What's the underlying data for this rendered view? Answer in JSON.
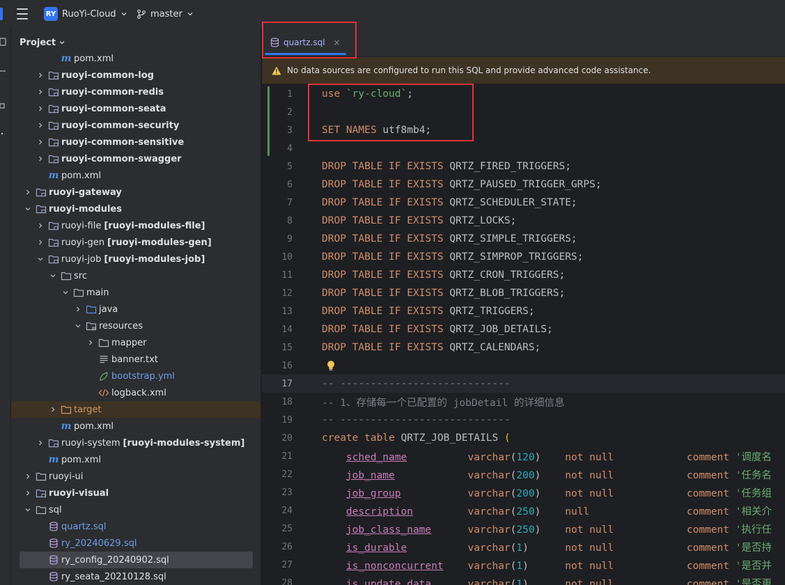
{
  "titlebar": {
    "project_badge": "RY",
    "project_name": "RuoYi-Cloud",
    "branch_name": "master"
  },
  "project_panel": {
    "title": "Project",
    "tree": [
      {
        "label": "pom.xml",
        "icon": "maven-icon",
        "depth": 4,
        "arrow": "none"
      },
      {
        "label": "ruoyi-common-log",
        "icon": "module-folder-icon",
        "depth": 3,
        "arrow": "right",
        "bold": true
      },
      {
        "label": "ruoyi-common-redis",
        "icon": "module-folder-icon",
        "depth": 3,
        "arrow": "right",
        "bold": true
      },
      {
        "label": "ruoyi-common-seata",
        "icon": "module-folder-icon",
        "depth": 3,
        "arrow": "right",
        "bold": true
      },
      {
        "label": "ruoyi-common-security",
        "icon": "module-folder-icon",
        "depth": 3,
        "arrow": "right",
        "bold": true
      },
      {
        "label": "ruoyi-common-sensitive",
        "icon": "module-folder-icon",
        "depth": 3,
        "arrow": "right",
        "bold": true
      },
      {
        "label": "ruoyi-common-swagger",
        "icon": "module-folder-icon",
        "depth": 3,
        "arrow": "right",
        "bold": true
      },
      {
        "label": "pom.xml",
        "icon": "maven-icon",
        "depth": 3,
        "arrow": "none"
      },
      {
        "label": "ruoyi-gateway",
        "icon": "module-folder-icon",
        "depth": 2,
        "arrow": "right",
        "bold": true
      },
      {
        "label": "ruoyi-modules",
        "icon": "module-folder-icon",
        "depth": 2,
        "arrow": "down",
        "bold": true
      },
      {
        "label": "ruoyi-file",
        "extra": "[ruoyi-modules-file]",
        "icon": "module-folder-icon",
        "depth": 3,
        "arrow": "right"
      },
      {
        "label": "ruoyi-gen",
        "extra": "[ruoyi-modules-gen]",
        "icon": "module-folder-icon",
        "depth": 3,
        "arrow": "right"
      },
      {
        "label": "ruoyi-job",
        "extra": "[ruoyi-modules-job]",
        "icon": "module-folder-icon",
        "depth": 3,
        "arrow": "down"
      },
      {
        "label": "src",
        "icon": "folder-icon",
        "depth": 4,
        "arrow": "down"
      },
      {
        "label": "main",
        "icon": "folder-icon",
        "depth": 5,
        "arrow": "down"
      },
      {
        "label": "java",
        "icon": "source-folder-icon",
        "depth": 6,
        "arrow": "right"
      },
      {
        "label": "resources",
        "icon": "resources-folder-icon",
        "depth": 6,
        "arrow": "down"
      },
      {
        "label": "mapper",
        "icon": "folder-icon",
        "depth": 7,
        "arrow": "right"
      },
      {
        "label": "banner.txt",
        "icon": "text-file-icon",
        "depth": 7,
        "arrow": "none"
      },
      {
        "label": "bootstrap.yml",
        "icon": "yaml-file-icon",
        "depth": 7,
        "arrow": "none",
        "color": "blue"
      },
      {
        "label": "logback.xml",
        "icon": "xml-file-icon",
        "depth": 7,
        "arrow": "none"
      },
      {
        "label": "target",
        "icon": "excluded-folder-icon",
        "depth": 4,
        "arrow": "right",
        "color": "orange",
        "highlight": "target"
      },
      {
        "label": "pom.xml",
        "icon": "maven-icon",
        "depth": 4,
        "arrow": "none"
      },
      {
        "label": "ruoyi-system",
        "extra": "[ruoyi-modules-system]",
        "icon": "module-folder-icon",
        "depth": 3,
        "arrow": "right"
      },
      {
        "label": "pom.xml",
        "icon": "maven-icon",
        "depth": 3,
        "arrow": "none"
      },
      {
        "label": "ruoyi-ui",
        "icon": "folder-icon",
        "depth": 2,
        "arrow": "right"
      },
      {
        "label": "ruoyi-visual",
        "icon": "module-folder-icon",
        "depth": 2,
        "arrow": "right",
        "bold": true
      },
      {
        "label": "sql",
        "icon": "folder-icon",
        "depth": 2,
        "arrow": "down"
      },
      {
        "label": "quartz.sql",
        "icon": "sql-file-icon",
        "depth": 3,
        "arrow": "none",
        "color": "blue"
      },
      {
        "label": "ry_20240629.sql",
        "icon": "sql-file-icon",
        "depth": 3,
        "arrow": "none",
        "color": "blue"
      },
      {
        "label": "ry_config_20240902.sql",
        "icon": "sql-file-icon",
        "depth": 3,
        "arrow": "none",
        "highlight": "selected"
      },
      {
        "label": "ry_seata_20210128.sql",
        "icon": "sql-file-icon",
        "depth": 3,
        "arrow": "none"
      }
    ]
  },
  "editor": {
    "tab_title": "quartz.sql",
    "tab_close": "×",
    "warning_text": "No data sources are configured to run this SQL and provide advanced code assistance.",
    "current_line": 17,
    "lines": [
      {
        "n": "1",
        "tokens": [
          [
            "kw",
            "use "
          ],
          [
            "str",
            "`ry-cloud`"
          ],
          [
            "ident",
            ";"
          ]
        ]
      },
      {
        "n": "2",
        "tokens": []
      },
      {
        "n": "3",
        "tokens": [
          [
            "kw",
            "SET NAMES "
          ],
          [
            "ident",
            "utf8mb4;"
          ]
        ]
      },
      {
        "n": "4",
        "tokens": []
      },
      {
        "n": "5",
        "tokens": [
          [
            "kw",
            "DROP TABLE IF EXISTS "
          ],
          [
            "ident",
            "QRTZ_FIRED_TRIGGERS;"
          ]
        ]
      },
      {
        "n": "6",
        "tokens": [
          [
            "kw",
            "DROP TABLE IF EXISTS "
          ],
          [
            "ident",
            "QRTZ_PAUSED_TRIGGER_GRPS;"
          ]
        ]
      },
      {
        "n": "7",
        "tokens": [
          [
            "kw",
            "DROP TABLE IF EXISTS "
          ],
          [
            "ident",
            "QRTZ_SCHEDULER_STATE;"
          ]
        ]
      },
      {
        "n": "8",
        "tokens": [
          [
            "kw",
            "DROP TABLE IF EXISTS "
          ],
          [
            "ident",
            "QRTZ_LOCKS;"
          ]
        ]
      },
      {
        "n": "9",
        "tokens": [
          [
            "kw",
            "DROP TABLE IF EXISTS "
          ],
          [
            "ident",
            "QRTZ_SIMPLE_TRIGGERS;"
          ]
        ]
      },
      {
        "n": "10",
        "tokens": [
          [
            "kw",
            "DROP TABLE IF EXISTS "
          ],
          [
            "ident",
            "QRTZ_SIMPROP_TRIGGERS;"
          ]
        ]
      },
      {
        "n": "11",
        "tokens": [
          [
            "kw",
            "DROP TABLE IF EXISTS "
          ],
          [
            "ident",
            "QRTZ_CRON_TRIGGERS;"
          ]
        ]
      },
      {
        "n": "12",
        "tokens": [
          [
            "kw",
            "DROP TABLE IF EXISTS "
          ],
          [
            "ident",
            "QRTZ_BLOB_TRIGGERS;"
          ]
        ]
      },
      {
        "n": "13",
        "tokens": [
          [
            "kw",
            "DROP TABLE IF EXISTS "
          ],
          [
            "ident",
            "QRTZ_TRIGGERS;"
          ]
        ]
      },
      {
        "n": "14",
        "tokens": [
          [
            "kw",
            "DROP TABLE IF EXISTS "
          ],
          [
            "ident",
            "QRTZ_JOB_DETAILS;"
          ]
        ]
      },
      {
        "n": "15",
        "tokens": [
          [
            "kw",
            "DROP TABLE IF EXISTS "
          ],
          [
            "ident",
            "QRTZ_CALENDARS;"
          ]
        ]
      },
      {
        "n": "16",
        "tokens": [],
        "bulb": true
      },
      {
        "n": "17",
        "tokens": [
          [
            "cm",
            "-- ----------------------------"
          ]
        ]
      },
      {
        "n": "18",
        "tokens": [
          [
            "cm",
            "-- 1、存储每一个已配置的 jobDetail 的详细信息"
          ]
        ]
      },
      {
        "n": "19",
        "tokens": [
          [
            "cm",
            "-- ----------------------------"
          ]
        ]
      },
      {
        "n": "20",
        "tokens": [
          [
            "kw",
            "create table "
          ],
          [
            "ident",
            "QRTZ_JOB_DETAILS "
          ],
          [
            "paren",
            "("
          ]
        ]
      },
      {
        "n": "21",
        "tokens": [
          [
            "ident",
            "    "
          ],
          [
            "col",
            "sched_name"
          ],
          [
            "ident",
            "          "
          ],
          [
            "ty",
            "varchar"
          ],
          [
            "ident",
            "("
          ],
          [
            "num",
            "120"
          ],
          [
            "ident",
            ")    "
          ],
          [
            "kw",
            "not null"
          ],
          [
            "ident",
            "            "
          ],
          [
            "kw",
            "comment "
          ],
          [
            "str",
            "'调度名"
          ]
        ]
      },
      {
        "n": "22",
        "tokens": [
          [
            "ident",
            "    "
          ],
          [
            "col",
            "job_name"
          ],
          [
            "ident",
            "            "
          ],
          [
            "ty",
            "varchar"
          ],
          [
            "ident",
            "("
          ],
          [
            "num",
            "200"
          ],
          [
            "ident",
            ")    "
          ],
          [
            "kw",
            "not null"
          ],
          [
            "ident",
            "            "
          ],
          [
            "kw",
            "comment "
          ],
          [
            "str",
            "'任务名"
          ]
        ]
      },
      {
        "n": "23",
        "tokens": [
          [
            "ident",
            "    "
          ],
          [
            "col",
            "job_group"
          ],
          [
            "ident",
            "           "
          ],
          [
            "ty",
            "varchar"
          ],
          [
            "ident",
            "("
          ],
          [
            "num",
            "200"
          ],
          [
            "ident",
            ")    "
          ],
          [
            "kw",
            "not null"
          ],
          [
            "ident",
            "            "
          ],
          [
            "kw",
            "comment "
          ],
          [
            "str",
            "'任务组"
          ]
        ]
      },
      {
        "n": "24",
        "tokens": [
          [
            "ident",
            "    "
          ],
          [
            "col",
            "description"
          ],
          [
            "ident",
            "         "
          ],
          [
            "ty",
            "varchar"
          ],
          [
            "ident",
            "("
          ],
          [
            "num",
            "250"
          ],
          [
            "ident",
            ")    "
          ],
          [
            "kw",
            "null"
          ],
          [
            "ident",
            "                "
          ],
          [
            "kw",
            "comment "
          ],
          [
            "str",
            "'相关介"
          ]
        ]
      },
      {
        "n": "25",
        "tokens": [
          [
            "ident",
            "    "
          ],
          [
            "col",
            "job_class_name"
          ],
          [
            "ident",
            "      "
          ],
          [
            "ty",
            "varchar"
          ],
          [
            "ident",
            "("
          ],
          [
            "num",
            "250"
          ],
          [
            "ident",
            ")    "
          ],
          [
            "kw",
            "not null"
          ],
          [
            "ident",
            "            "
          ],
          [
            "kw",
            "comment "
          ],
          [
            "str",
            "'执行任"
          ]
        ]
      },
      {
        "n": "26",
        "tokens": [
          [
            "ident",
            "    "
          ],
          [
            "col",
            "is_durable"
          ],
          [
            "ident",
            "          "
          ],
          [
            "ty",
            "varchar"
          ],
          [
            "ident",
            "("
          ],
          [
            "num",
            "1"
          ],
          [
            "ident",
            ")      "
          ],
          [
            "kw",
            "not null"
          ],
          [
            "ident",
            "            "
          ],
          [
            "kw",
            "comment "
          ],
          [
            "str",
            "'是否持"
          ]
        ]
      },
      {
        "n": "27",
        "tokens": [
          [
            "ident",
            "    "
          ],
          [
            "col",
            "is_nonconcurrent"
          ],
          [
            "ident",
            "    "
          ],
          [
            "ty",
            "varchar"
          ],
          [
            "ident",
            "("
          ],
          [
            "num",
            "1"
          ],
          [
            "ident",
            ")      "
          ],
          [
            "kw",
            "not null"
          ],
          [
            "ident",
            "            "
          ],
          [
            "kw",
            "comment "
          ],
          [
            "str",
            "'是否并"
          ]
        ]
      },
      {
        "n": "28",
        "tokens": [
          [
            "ident",
            "    "
          ],
          [
            "col",
            "is_update_data"
          ],
          [
            "ident",
            "      "
          ],
          [
            "ty",
            "varchar"
          ],
          [
            "ident",
            "("
          ],
          [
            "num",
            "1"
          ],
          [
            "ident",
            ")      "
          ],
          [
            "kw",
            "not null"
          ],
          [
            "ident",
            "            "
          ],
          [
            "kw",
            "comment "
          ],
          [
            "str",
            "'是否更"
          ]
        ]
      }
    ]
  }
}
